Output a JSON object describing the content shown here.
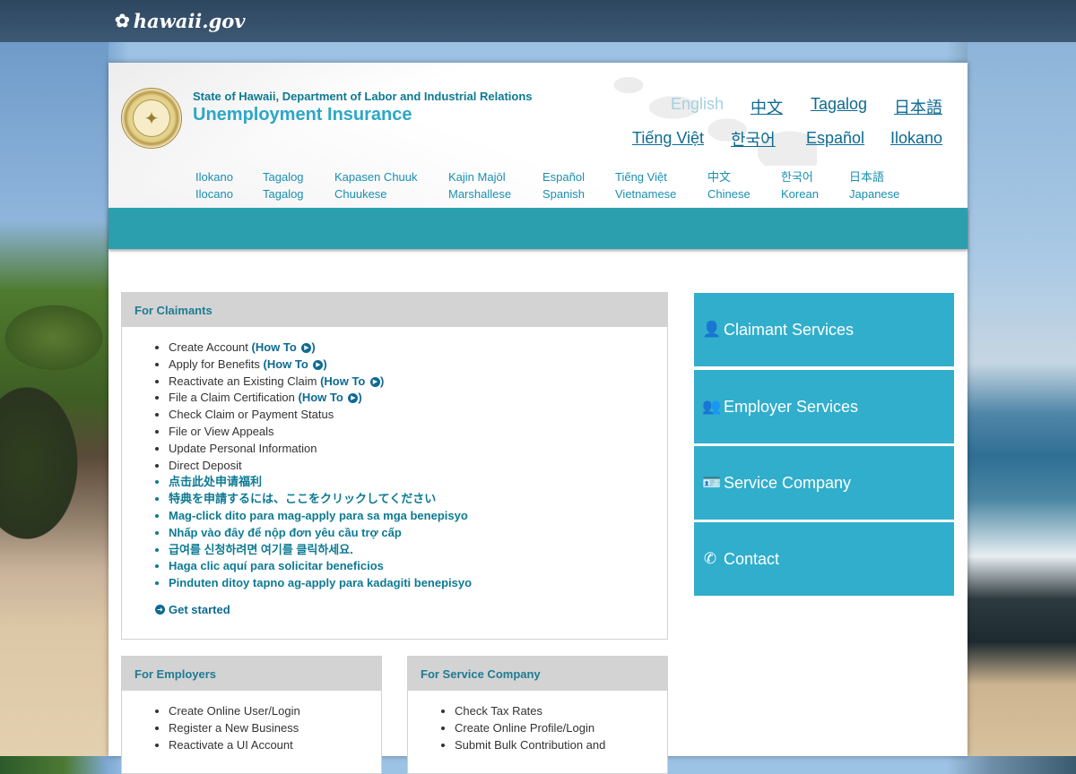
{
  "site": {
    "logo_text": "hawaii.gov"
  },
  "header": {
    "dept": "State of Hawaii, Department of Labor and Industrial Relations",
    "title": "Unemployment Insurance",
    "languages_primary": [
      "English",
      "中文",
      "Tagalog",
      "日本語",
      "Tiếng Việt",
      "한국어",
      "Español",
      "Ilokano"
    ],
    "languages_secondary": [
      {
        "native": "Ilokano",
        "english": "Ilocano"
      },
      {
        "native": "Tagalog",
        "english": "Tagalog"
      },
      {
        "native": "Kapasen Chuuk",
        "english": "Chuukese"
      },
      {
        "native": "Kajin Majōl",
        "english": "Marshallese"
      },
      {
        "native": "Español",
        "english": "Spanish"
      },
      {
        "native": "Tiếng Việt",
        "english": "Vietnamese"
      },
      {
        "native": "中文",
        "english": "Chinese"
      },
      {
        "native": "한국어",
        "english": "Korean"
      },
      {
        "native": "日本語",
        "english": "Japanese"
      }
    ]
  },
  "claimants": {
    "heading": "For Claimants",
    "items": [
      {
        "text": "Create Account ",
        "howto": "(How To ",
        "howto_end": ")"
      },
      {
        "text": "Apply for Benefits ",
        "howto": "(How To ",
        "howto_end": ")"
      },
      {
        "text": "Reactivate an Existing Claim ",
        "howto": "(How To ",
        "howto_end": ")"
      },
      {
        "text": "File a Claim Certification ",
        "howto": "(How To ",
        "howto_end": ")"
      },
      {
        "text": "Check Claim or Payment Status"
      },
      {
        "text": "File or View Appeals"
      },
      {
        "text": "Update Personal Information"
      },
      {
        "text": "Direct Deposit"
      }
    ],
    "intl_links": [
      "点击此处申请福利",
      "特典を申請するには、ここをクリックしてください",
      "Mag-click dito para mag-apply para sa mga benepisyo",
      "Nhấp vào đây để nộp đơn yêu cầu trợ cấp",
      "급여를 신청하려면 여기를 클릭하세요.",
      "Haga clic aquí para solicitar beneficios",
      "Pinduten ditoy tapno ag-apply para kadagiti benepisyo"
    ],
    "get_started": "Get started"
  },
  "employers": {
    "heading": "For Employers",
    "items": [
      "Create Online User/Login",
      "Register a New Business",
      "Reactivate a UI Account"
    ]
  },
  "service_company": {
    "heading": "For Service Company",
    "items": [
      "Check Tax Rates",
      "Create Online Profile/Login",
      "Submit Bulk Contribution and"
    ]
  },
  "side_nav": [
    {
      "label": "Claimant Services",
      "icon": "user-icon"
    },
    {
      "label": "Employer Services",
      "icon": "users-icon"
    },
    {
      "label": "Service Company",
      "icon": "id-card-icon"
    },
    {
      "label": "Contact",
      "icon": "phone-icon"
    }
  ],
  "colors": {
    "accent": "#31aecc",
    "teal_bar": "#2b9fad",
    "link": "#0d6a92"
  }
}
